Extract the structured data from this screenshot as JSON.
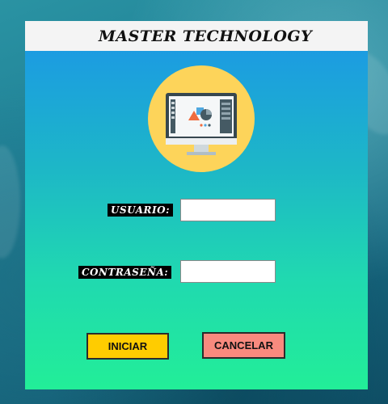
{
  "window": {
    "title": "MASTER TECHNOLOGY",
    "logo_icon": "monitor-design-icon"
  },
  "form": {
    "username_label": "USUARIO:",
    "username_value": "",
    "password_label": "CONTRASEÑA:",
    "password_value": ""
  },
  "buttons": {
    "start_label": "INICIAR",
    "cancel_label": "CANCELAR"
  },
  "colors": {
    "title_bar": "#f4f4f4",
    "gradient_top": "#1b95e8",
    "gradient_bottom": "#22ee98",
    "logo_circle": "#fdd45a",
    "start_button": "#ffcc00",
    "cancel_button": "#f88a7e"
  }
}
